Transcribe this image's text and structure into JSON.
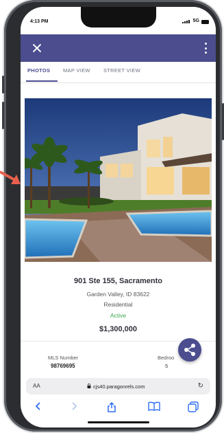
{
  "status_bar": {
    "time": "4:13 PM",
    "network": "5G"
  },
  "app_bar": {
    "close_icon": "close-icon",
    "menu_icon": "more-vert-icon"
  },
  "tabs": [
    {
      "label": "PHOTOS",
      "active": true
    },
    {
      "label": "MAP VIEW",
      "active": false
    },
    {
      "label": "STREET VIEW",
      "active": false
    }
  ],
  "listing": {
    "address": "901 Ste 155, Sacramento",
    "city_state": "Garden Valley, ID 83622",
    "property_type": "Residential",
    "status": "Active",
    "price": "$1,300,000",
    "mls_label": "MLS Number",
    "mls_value": "98769695",
    "bedrooms_label": "Bedroo",
    "bedrooms_value": "5"
  },
  "share_button": {
    "icon": "share-icon"
  },
  "browser": {
    "aa_label": "AA",
    "url": "cjs40.paragonrels.com",
    "reload_icon": "reload-icon",
    "toolbar_icons": [
      "back-icon",
      "forward-icon",
      "share-icon",
      "bookmarks-icon",
      "tabs-icon"
    ]
  },
  "colors": {
    "accent": "#4b4d8f",
    "status_active": "#3aa74b",
    "arrow": "#e8604d"
  }
}
